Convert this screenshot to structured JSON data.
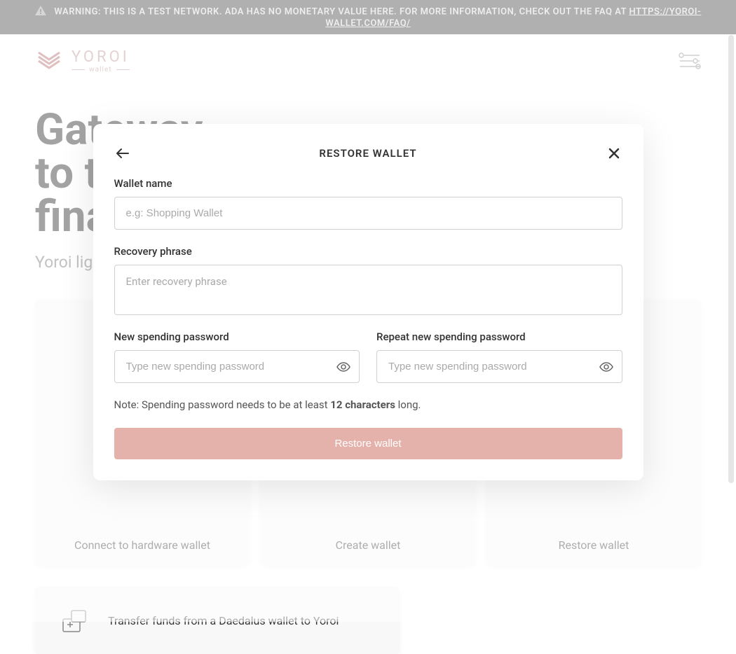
{
  "banner": {
    "text": "WARNING: THIS IS A TEST NETWORK. ADA HAS NO MONETARY VALUE HERE. FOR MORE INFORMATION, CHECK OUT THE FAQ AT ",
    "link_text": "HTTPS://YOROI-WALLET.COM/FAQ/"
  },
  "logo": {
    "main": "YOROI",
    "sub": "wallet"
  },
  "hero": {
    "title_line1": "Gateway",
    "title_line2": "to the",
    "title_line3": "financial",
    "subtitle": "Yoroi lig"
  },
  "cards": {
    "hardware": "Connect to hardware wallet",
    "create": "Create wallet",
    "restore": "Restore wallet"
  },
  "transfer": {
    "label": "Transfer funds from a Daedalus wallet to Yoroi"
  },
  "modal": {
    "title": "RESTORE WALLET",
    "wallet_name_label": "Wallet name",
    "wallet_name_placeholder": "e.g: Shopping Wallet",
    "recovery_label": "Recovery phrase",
    "recovery_placeholder": "Enter recovery phrase",
    "new_password_label": "New spending password",
    "new_password_placeholder": "Type new spending password",
    "repeat_password_label": "Repeat new spending password",
    "repeat_password_placeholder": "Type new spending password",
    "note_prefix": "Note: Spending password needs to be at least ",
    "note_bold": "12 characters",
    "note_suffix": " long.",
    "restore_button": "Restore wallet"
  }
}
